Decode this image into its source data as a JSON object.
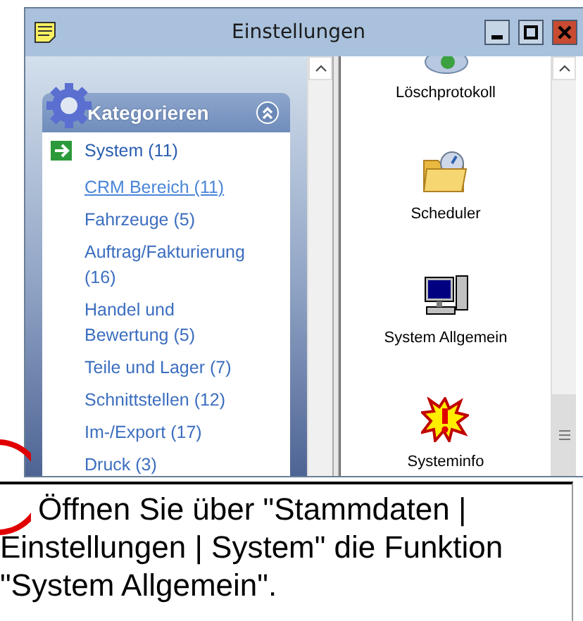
{
  "window": {
    "title": "Einstellungen"
  },
  "categories": {
    "title": "Kategorieren",
    "expanded": true,
    "items": [
      {
        "label": "System (11)",
        "selected": true,
        "hovered": false
      },
      {
        "label": "CRM Bereich (11)",
        "selected": false,
        "hovered": true
      },
      {
        "label": "Fahrzeuge (5)",
        "selected": false,
        "hovered": false
      },
      {
        "label": "Auftrag/Fakturierung (16)",
        "selected": false,
        "hovered": false
      },
      {
        "label": "Handel und Bewertung (5)",
        "selected": false,
        "hovered": false
      },
      {
        "label": "Teile und Lager (7)",
        "selected": false,
        "hovered": false
      },
      {
        "label": "Schnittstellen (12)",
        "selected": false,
        "hovered": false
      },
      {
        "label": "Im-/Export (17)",
        "selected": false,
        "hovered": false
      },
      {
        "label": "Druck (3)",
        "selected": false,
        "hovered": false
      }
    ]
  },
  "functions": [
    {
      "label": "Löschprotokoll",
      "kind": "disc"
    },
    {
      "label": "Scheduler",
      "kind": "scheduler"
    },
    {
      "label": "System Allgemein",
      "kind": "computer"
    },
    {
      "label": "Systeminfo",
      "kind": "alert"
    }
  ],
  "caption": "Öffnen Sie über \"Stammdaten | Einstellungen | System\" die Funktion \"System Allgemein\"."
}
